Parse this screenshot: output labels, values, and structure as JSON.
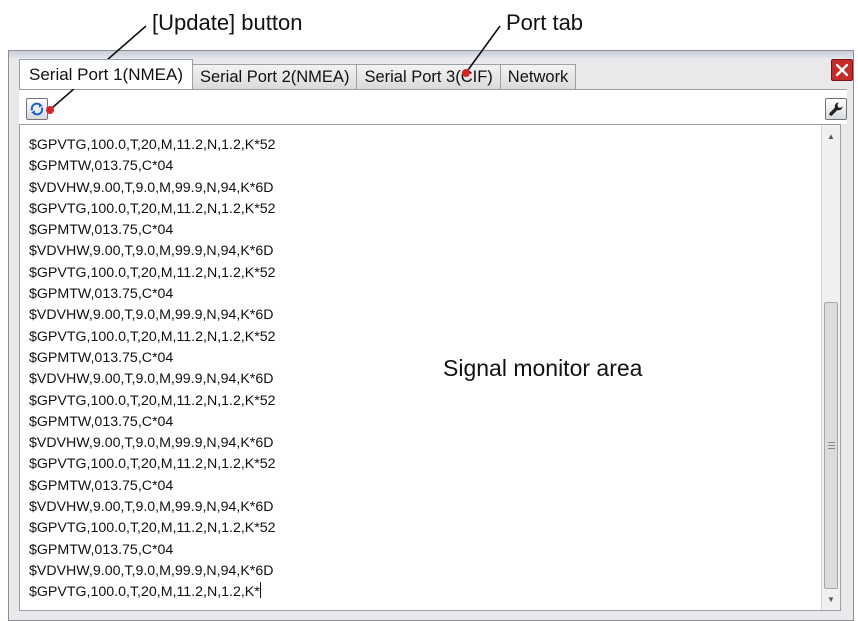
{
  "callouts": {
    "update_button": "[Update] button",
    "port_tab": "Port tab",
    "signal_area": "Signal monitor area"
  },
  "tabs": [
    {
      "label": "Serial Port 1(NMEA)",
      "active": true
    },
    {
      "label": "Serial Port 2(NMEA)",
      "active": false
    },
    {
      "label": "Serial Port 3(CIF)",
      "active": false
    },
    {
      "label": "Network",
      "active": false
    }
  ],
  "icons": {
    "update": "refresh-icon",
    "settings": "wrench-icon",
    "close": "close-icon"
  },
  "colors": {
    "close": "#c62a2a",
    "update_icon": "#1b5fd0"
  },
  "monitor": {
    "lines": [
      "$GPVTG,100.0,T,20,M,11.2,N,1.2,K*52",
      "$GPMTW,013.75,C*04",
      "$VDVHW,9.00,T,9.0,M,99.9,N,94,K*6D",
      "$GPVTG,100.0,T,20,M,11.2,N,1.2,K*52",
      "$GPMTW,013.75,C*04",
      "$VDVHW,9.00,T,9.0,M,99.9,N,94,K*6D",
      "$GPVTG,100.0,T,20,M,11.2,N,1.2,K*52",
      "$GPMTW,013.75,C*04",
      "$VDVHW,9.00,T,9.0,M,99.9,N,94,K*6D",
      "$GPVTG,100.0,T,20,M,11.2,N,1.2,K*52",
      "$GPMTW,013.75,C*04",
      "$VDVHW,9.00,T,9.0,M,99.9,N,94,K*6D",
      "$GPVTG,100.0,T,20,M,11.2,N,1.2,K*52",
      "$GPMTW,013.75,C*04",
      "$VDVHW,9.00,T,9.0,M,99.9,N,94,K*6D",
      "$GPVTG,100.0,T,20,M,11.2,N,1.2,K*52",
      "$GPMTW,013.75,C*04",
      "$VDVHW,9.00,T,9.0,M,99.9,N,94,K*6D",
      "$GPVTG,100.0,T,20,M,11.2,N,1.2,K*52",
      "$GPMTW,013.75,C*04",
      "$VDVHW,9.00,T,9.0,M,99.9,N,94,K*6D",
      "$GPVTG,100.0,T,20,M,11.2,N,1.2,K*"
    ]
  }
}
